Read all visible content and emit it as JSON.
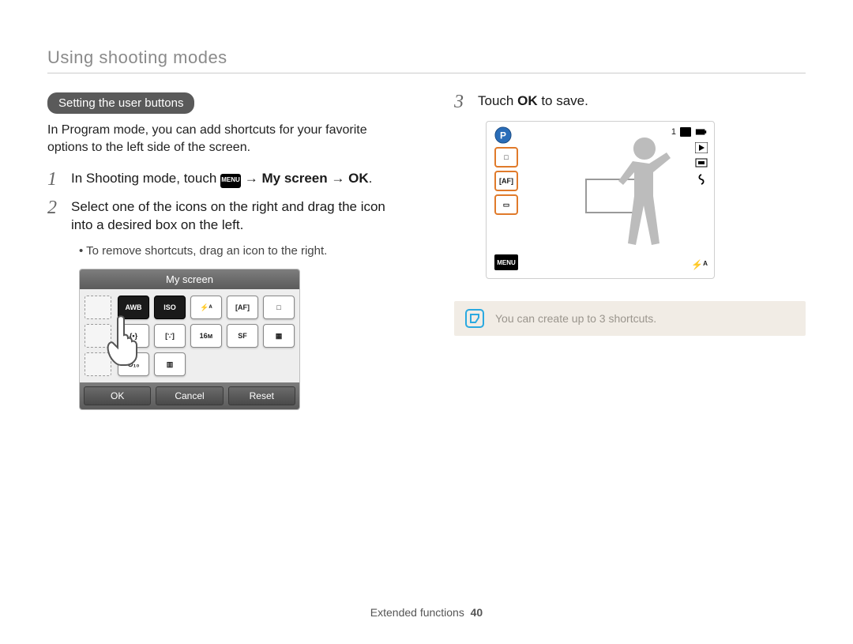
{
  "section_header": "Using shooting modes",
  "left": {
    "pill": "Setting the user buttons",
    "intro": "In Program mode, you can add shortcuts for your favorite options to the left side of the screen.",
    "step1": {
      "prefix": "In Shooting mode, touch ",
      "menu_icon_label": "MENU",
      "path": " → My screen → OK",
      "suffix": "."
    },
    "step2": "Select one of the icons on the right and drag the icon into a desired box on the left.",
    "step2_sub": "To remove shortcuts, drag an icon to the right.",
    "myscreen": {
      "title": "My screen",
      "icons": [
        "AWB",
        "ISO",
        "⚡ᴬ",
        "[AF]",
        "□",
        "{•}",
        "[∵]",
        "16ᴍ",
        "SF",
        "▦",
        "⏱₁₀",
        "▥"
      ],
      "buttons": {
        "ok": "OK",
        "cancel": "Cancel",
        "reset": "Reset"
      }
    }
  },
  "right": {
    "step3_prefix": "Touch ",
    "step3_bold": "OK",
    "step3_suffix": " to save.",
    "preview": {
      "mode_letter": "P",
      "top_right_count": "1",
      "left_chips": [
        "□",
        "[AF]",
        "▭"
      ],
      "menu_label": "MENU",
      "flash_auto": "⚡ᴬ"
    },
    "note": "You can create up to 3 shortcuts."
  },
  "footer": {
    "section": "Extended functions",
    "page": "40"
  }
}
